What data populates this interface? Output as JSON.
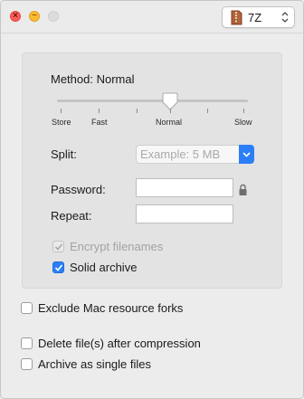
{
  "toolbar": {
    "format_label": "7Z",
    "format_icon": "archive-box-icon"
  },
  "compression": {
    "method_label": "Method: Normal",
    "level": 0.6,
    "ticks": [
      "Store",
      "Fast",
      "",
      "Normal",
      "",
      "Slow"
    ]
  },
  "split": {
    "label": "Split:",
    "placeholder": "Example: 5 MB"
  },
  "password": {
    "label": "Password:",
    "repeat_label": "Repeat:",
    "value": "",
    "repeat_value": ""
  },
  "options": {
    "encrypt_filenames": {
      "label": "Encrypt filenames",
      "checked": true,
      "enabled": false
    },
    "solid_archive": {
      "label": "Solid archive",
      "checked": true
    },
    "exclude_mac_forks": {
      "label": "Exclude Mac resource forks",
      "checked": false
    },
    "delete_after": {
      "label": "Delete file(s) after compression",
      "checked": false
    },
    "single_files": {
      "label": "Archive as single files",
      "checked": false
    }
  },
  "colors": {
    "accent": "#2a7ff6",
    "window_bg": "#ececec",
    "panel_bg": "#e3e3e3",
    "close": "#fc5f57",
    "minimize": "#fdbc2e"
  }
}
